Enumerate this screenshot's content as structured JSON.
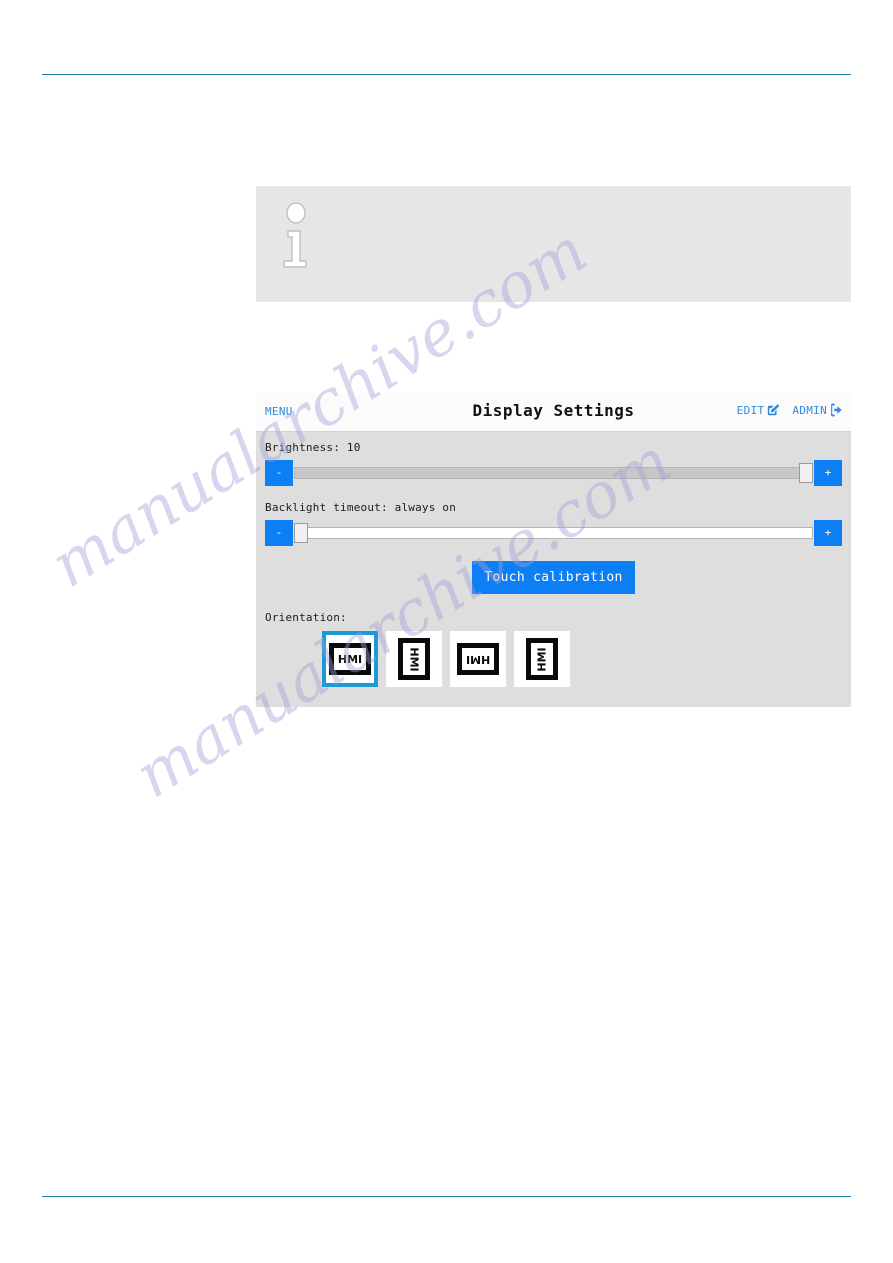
{
  "page": {
    "rule_color": "#1b7fa8",
    "watermark_text": "manualarchive.com"
  },
  "info_box": {
    "icon": "info-i-icon",
    "text": ""
  },
  "hmi": {
    "header": {
      "menu_label": "MENU",
      "title": "Display Settings",
      "edit_label": "EDIT",
      "edit_icon": "edit-square-pencil-icon",
      "admin_label": "ADMIN",
      "admin_icon": "logout-arrow-icon"
    },
    "brightness": {
      "label": "Brightness: 10",
      "value": 10,
      "minus_label": "-",
      "plus_label": "+",
      "thumb_position": "max"
    },
    "backlight": {
      "label": "Backlight timeout: always on",
      "value": "always on",
      "minus_label": "-",
      "plus_label": "+",
      "thumb_position": "min"
    },
    "touch_calibration": {
      "label": "Touch calibration"
    },
    "orientation": {
      "label": "Orientation:",
      "screen_text": "HMI",
      "options": [
        {
          "name": "orientation-0",
          "rotation": 0,
          "shape": "landscape",
          "selected": true
        },
        {
          "name": "orientation-90",
          "rotation": 90,
          "shape": "portrait",
          "selected": false
        },
        {
          "name": "orientation-180",
          "rotation": 180,
          "shape": "landscape",
          "selected": false
        },
        {
          "name": "orientation-270",
          "rotation": 270,
          "shape": "portrait",
          "selected": false
        }
      ]
    },
    "colors": {
      "accent_blue": "#0d7ff5",
      "link_blue": "#2d8ae0",
      "select_blue": "#1b9ad6",
      "panel_bg": "#dedede",
      "header_bg": "#fbfbfb"
    }
  }
}
